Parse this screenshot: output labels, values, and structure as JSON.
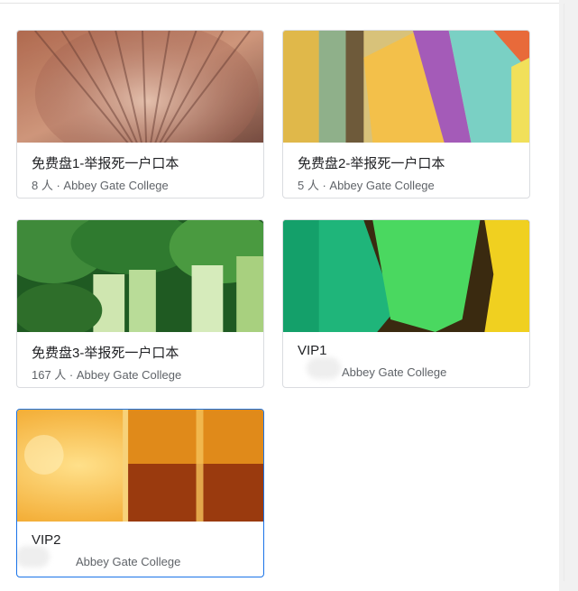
{
  "classes": [
    {
      "title": "免费盘1-举报死一户口本",
      "members": "8 人",
      "separator": " · ",
      "school": "Abbey Gate College",
      "thumb": "shell"
    },
    {
      "title": "免费盘2-举报死一户口本",
      "members": "5 人",
      "separator": " · ",
      "school": "Abbey Gate College",
      "thumb": "sticky-notes"
    },
    {
      "title": "免费盘3-举报死一户口本",
      "members": "167 人",
      "separator": " · ",
      "school": "Abbey Gate College",
      "thumb": "greens"
    },
    {
      "title": "VIP1",
      "members": "",
      "separator": "",
      "school": "Abbey Gate College",
      "thumb": "pencils"
    },
    {
      "title": "VIP2",
      "members": "",
      "separator": "",
      "school": "Abbey Gate College",
      "thumb": "glass"
    }
  ]
}
